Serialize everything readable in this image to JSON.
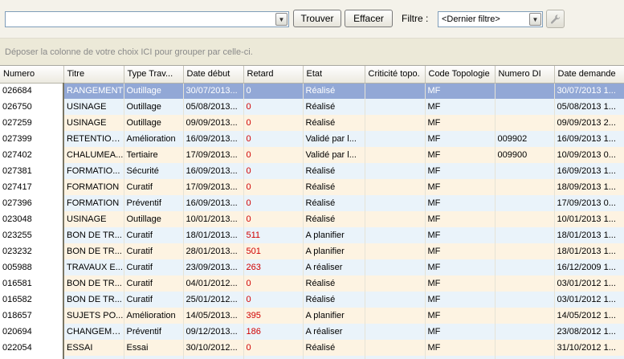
{
  "toolbar": {
    "search_value": "",
    "find_label": "Trouver",
    "clear_label": "Effacer",
    "filter_label": "Filtre :",
    "filter_selected": "<Dernier filtre>"
  },
  "group_hint": "Déposer la colonne de votre choix ICI pour grouper par celle-ci.",
  "columns": [
    "Numero",
    "Titre",
    "Type Trav...",
    "Date début",
    "Retard",
    "Etat",
    "Criticité topo.",
    "Code Topologie",
    "Numero DI",
    "Date demande"
  ],
  "rows": [
    {
      "numero": "026684",
      "titre": "RANGEMENT",
      "type": "Outillage",
      "date_debut": "30/07/2013...",
      "retard": "0",
      "etat": "Réalisé",
      "criticite": "",
      "code_topo": "MF",
      "numero_di": "",
      "date_demande": "30/07/2013 1..."
    },
    {
      "numero": "026750",
      "titre": "USINAGE",
      "type": "Outillage",
      "date_debut": "05/08/2013...",
      "retard": "0",
      "etat": "Réalisé",
      "criticite": "",
      "code_topo": "MF",
      "numero_di": "",
      "date_demande": "05/08/2013 1..."
    },
    {
      "numero": "027259",
      "titre": "USINAGE",
      "type": "Outillage",
      "date_debut": "09/09/2013...",
      "retard": "0",
      "etat": "Réalisé",
      "criticite": "",
      "code_topo": "MF",
      "numero_di": "",
      "date_demande": "09/09/2013 2..."
    },
    {
      "numero": "027399",
      "titre": "RETENTION...",
      "type": "Amélioration",
      "date_debut": "16/09/2013...",
      "retard": "0",
      "etat": "Validé par l...",
      "criticite": "",
      "code_topo": "MF",
      "numero_di": "009902",
      "date_demande": "16/09/2013 1..."
    },
    {
      "numero": "027402",
      "titre": "CHALUMEA...",
      "type": "Tertiaire",
      "date_debut": "17/09/2013...",
      "retard": "0",
      "etat": "Validé par l...",
      "criticite": "",
      "code_topo": "MF",
      "numero_di": "009900",
      "date_demande": "10/09/2013 0..."
    },
    {
      "numero": "027381",
      "titre": "FORMATIO...",
      "type": "Sécurité",
      "date_debut": "16/09/2013...",
      "retard": "0",
      "etat": "Réalisé",
      "criticite": "",
      "code_topo": "MF",
      "numero_di": "",
      "date_demande": "16/09/2013 1..."
    },
    {
      "numero": "027417",
      "titre": "FORMATION",
      "type": "Curatif",
      "date_debut": "17/09/2013...",
      "retard": "0",
      "etat": "Réalisé",
      "criticite": "",
      "code_topo": "MF",
      "numero_di": "",
      "date_demande": "18/09/2013 1..."
    },
    {
      "numero": "027396",
      "titre": "FORMATION",
      "type": "Préventif",
      "date_debut": "16/09/2013...",
      "retard": "0",
      "etat": "Réalisé",
      "criticite": "",
      "code_topo": "MF",
      "numero_di": "",
      "date_demande": "17/09/2013 0..."
    },
    {
      "numero": "023048",
      "titre": "USINAGE",
      "type": "Outillage",
      "date_debut": "10/01/2013...",
      "retard": "0",
      "etat": "Réalisé",
      "criticite": "",
      "code_topo": "MF",
      "numero_di": "",
      "date_demande": "10/01/2013 1..."
    },
    {
      "numero": "023255",
      "titre": "BON DE TR...",
      "type": "Curatif",
      "date_debut": "18/01/2013...",
      "retard": "511",
      "etat": "A planifier",
      "criticite": "",
      "code_topo": "MF",
      "numero_di": "",
      "date_demande": "18/01/2013 1..."
    },
    {
      "numero": "023232",
      "titre": "BON DE TR...",
      "type": "Curatif",
      "date_debut": "28/01/2013...",
      "retard": "501",
      "etat": "A planifier",
      "criticite": "",
      "code_topo": "MF",
      "numero_di": "",
      "date_demande": "18/01/2013 1..."
    },
    {
      "numero": "005988",
      "titre": "TRAVAUX E...",
      "type": "Curatif",
      "date_debut": "23/09/2013...",
      "retard": "263",
      "etat": "A réaliser",
      "criticite": "",
      "code_topo": "MF",
      "numero_di": "",
      "date_demande": "16/12/2009 1..."
    },
    {
      "numero": "016581",
      "titre": "BON DE TR...",
      "type": "Curatif",
      "date_debut": "04/01/2012...",
      "retard": "0",
      "etat": "Réalisé",
      "criticite": "",
      "code_topo": "MF",
      "numero_di": "",
      "date_demande": "03/01/2012 1..."
    },
    {
      "numero": "016582",
      "titre": "BON DE TR...",
      "type": "Curatif",
      "date_debut": "25/01/2012...",
      "retard": "0",
      "etat": "Réalisé",
      "criticite": "",
      "code_topo": "MF",
      "numero_di": "",
      "date_demande": "03/01/2012 1..."
    },
    {
      "numero": "018657",
      "titre": "SUJETS PO...",
      "type": "Amélioration",
      "date_debut": "14/05/2013...",
      "retard": "395",
      "etat": "A planifier",
      "criticite": "",
      "code_topo": "MF",
      "numero_di": "",
      "date_demande": "14/05/2012 1..."
    },
    {
      "numero": "020694",
      "titre": "CHANGEME...",
      "type": "Préventif",
      "date_debut": "09/12/2013...",
      "retard": "186",
      "etat": "A réaliser",
      "criticite": "",
      "code_topo": "MF",
      "numero_di": "",
      "date_demande": "23/08/2012 1..."
    },
    {
      "numero": "022054",
      "titre": "ESSAI",
      "type": "Essai",
      "date_debut": "30/10/2012...",
      "retard": "0",
      "etat": "Réalisé",
      "criticite": "",
      "code_topo": "MF",
      "numero_di": "",
      "date_demande": "31/10/2012 1..."
    },
    {
      "numero": "",
      "titre": "",
      "type": "",
      "date_debut": "",
      "retard": "",
      "etat": "",
      "criticite": "",
      "code_topo": "",
      "numero_di": "",
      "date_demande": ""
    }
  ],
  "selected_row": 0,
  "colors": {
    "selected_row": "#92a8d6",
    "row_even": "#fdf3e2",
    "row_odd": "#eaf3fa",
    "retard": "#d00000"
  }
}
